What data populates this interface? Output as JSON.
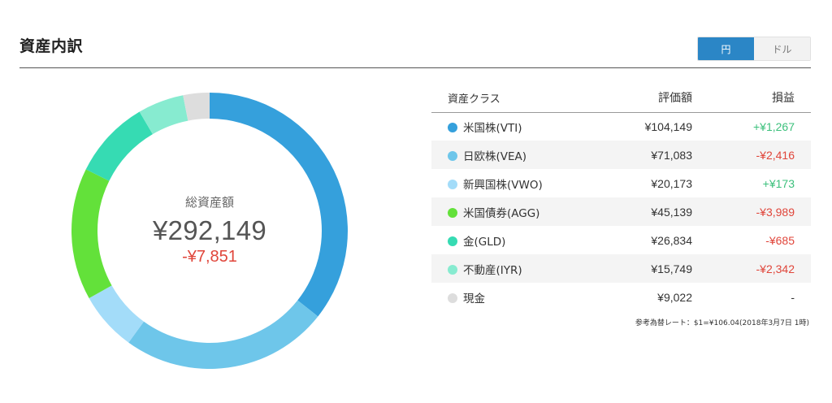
{
  "section": {
    "title": "資産内訳"
  },
  "currency_toggle": {
    "options": [
      "円",
      "ドル"
    ],
    "selected": "円"
  },
  "summary": {
    "label": "総資産額",
    "total": "¥292,149",
    "profit_loss": "-¥7,851"
  },
  "table": {
    "headers": {
      "class": "資産クラス",
      "value": "評価額",
      "profit_loss": "損益"
    },
    "rows": [
      {
        "name": "米国株(VTI)",
        "value": "¥104,149",
        "profit_loss": "+¥1,267",
        "pl_sign": "pos",
        "color": "#35a0dc"
      },
      {
        "name": "日欧株(VEA)",
        "value": "¥71,083",
        "profit_loss": "-¥2,416",
        "pl_sign": "neg",
        "color": "#6ec6ea"
      },
      {
        "name": "新興国株(VWO)",
        "value": "¥20,173",
        "profit_loss": "+¥173",
        "pl_sign": "pos",
        "color": "#a3dcf9"
      },
      {
        "name": "米国債券(AGG)",
        "value": "¥45,139",
        "profit_loss": "-¥3,989",
        "pl_sign": "neg",
        "color": "#63e13a"
      },
      {
        "name": "金(GLD)",
        "value": "¥26,834",
        "profit_loss": "-¥685",
        "pl_sign": "neg",
        "color": "#36dbb3"
      },
      {
        "name": "不動産(IYR)",
        "value": "¥15,749",
        "profit_loss": "-¥2,342",
        "pl_sign": "neg",
        "color": "#87ebd0"
      },
      {
        "name": "現金",
        "value": "¥9,022",
        "profit_loss": "-",
        "pl_sign": "neutral",
        "color": "#dddddd"
      }
    ]
  },
  "rate_note": "参考為替レート：$1=¥106.04(2018年3月7日 1時)",
  "chart_data": {
    "type": "pie",
    "categories": [
      "米国株(VTI)",
      "日欧株(VEA)",
      "新興国株(VWO)",
      "米国債券(AGG)",
      "金(GLD)",
      "不動産(IYR)",
      "現金"
    ],
    "values": [
      104149,
      71083,
      20173,
      45139,
      26834,
      15749,
      9022
    ],
    "colors": [
      "#35a0dc",
      "#6ec6ea",
      "#a3dcf9",
      "#63e13a",
      "#36dbb3",
      "#87ebd0",
      "#dddddd"
    ]
  }
}
